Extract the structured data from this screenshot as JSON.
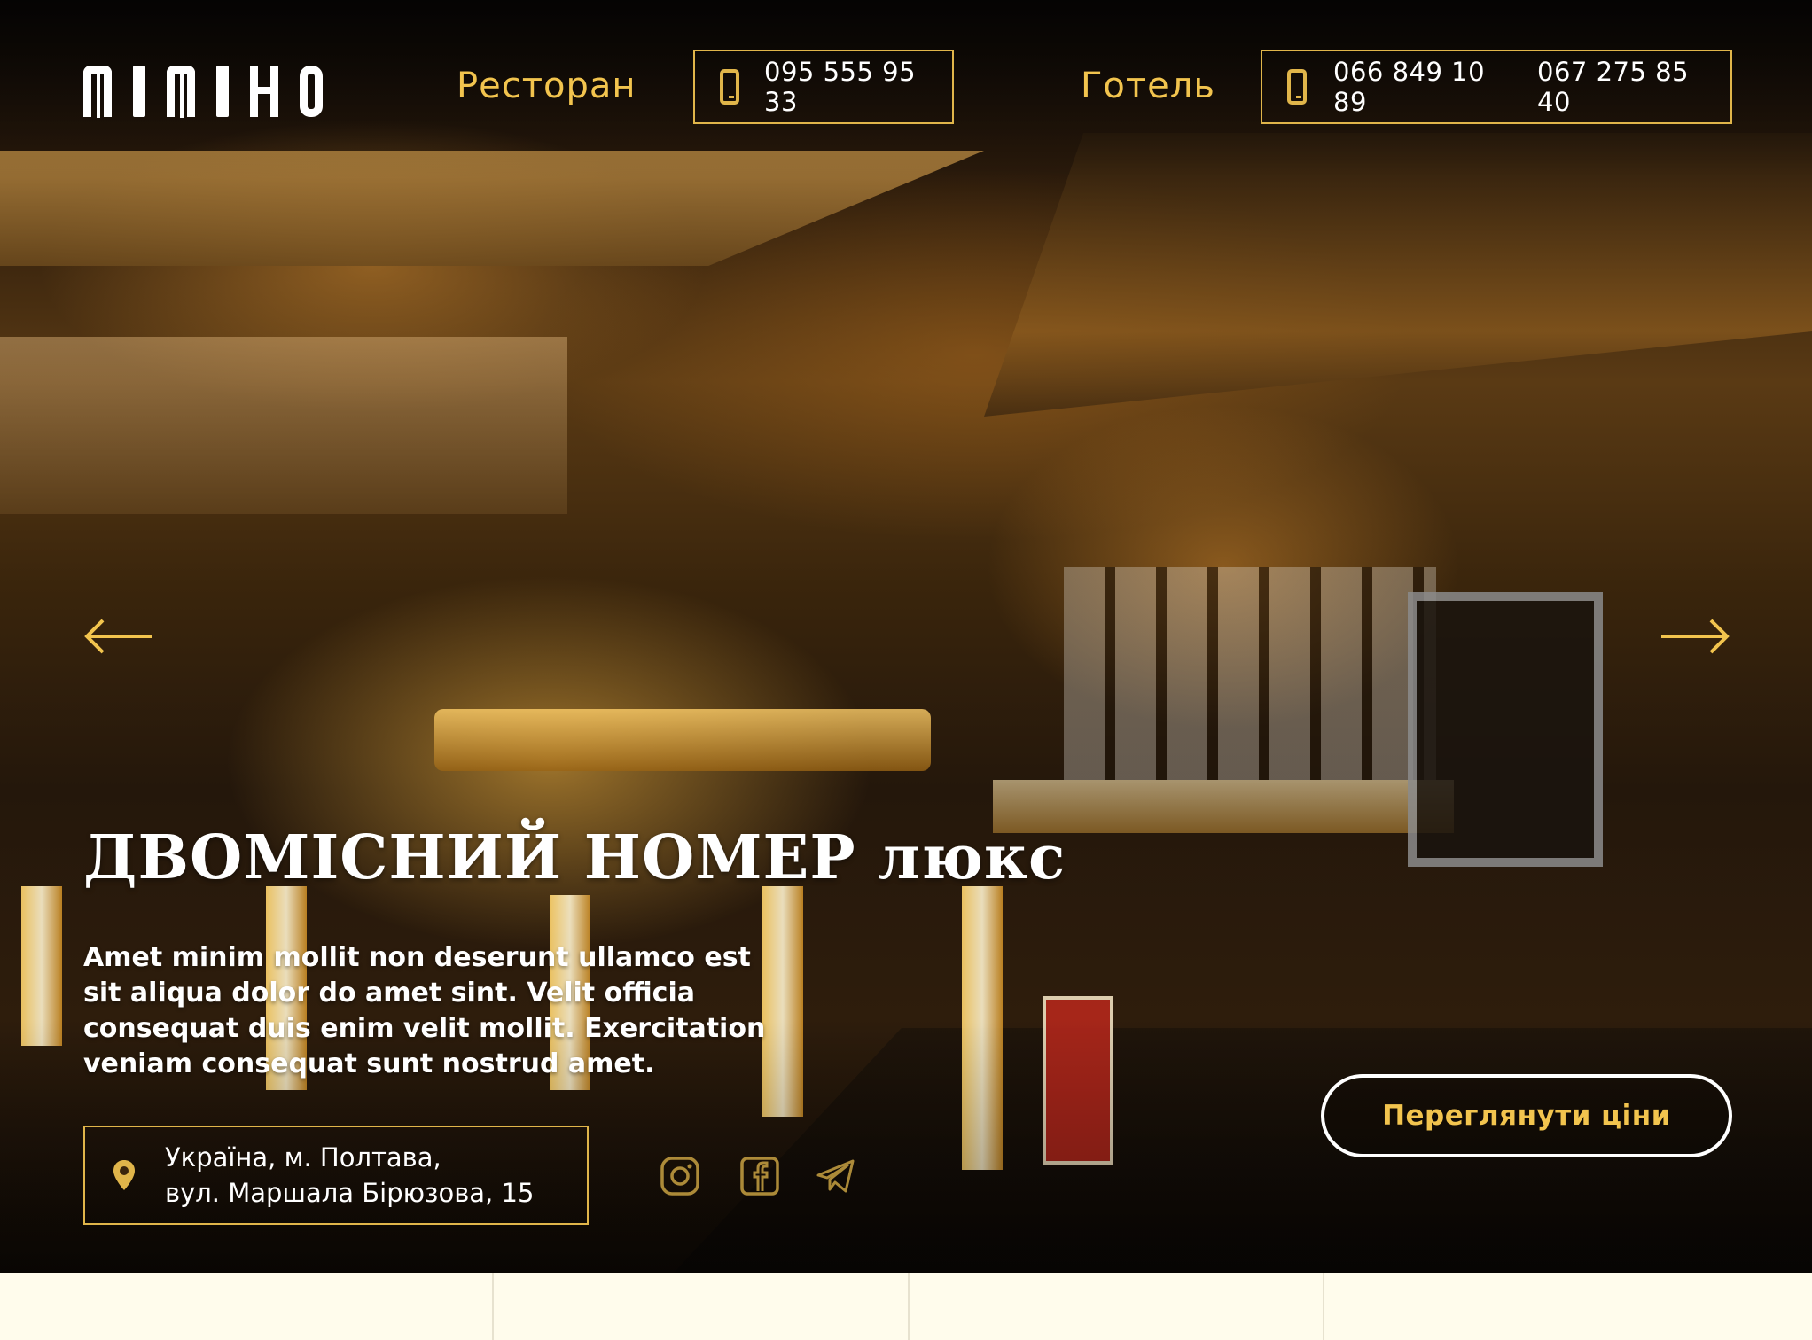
{
  "header": {
    "logo_text": "MIMIHO",
    "nav": [
      {
        "label": "Ресторан",
        "phones": [
          "095 555 95 33"
        ]
      },
      {
        "label": "Готель",
        "phones": [
          "066 849 10 89",
          "067 275 85 40"
        ]
      }
    ]
  },
  "hero": {
    "title": "ДВОМІСНИЙ НОМЕР люкс",
    "description": "Amet minim mollit non deserunt ullamco est sit aliqua dolor do amet sint. Velit officia consequat duis enim velit mollit. Exercitation veniam consequat sunt nostrud amet.",
    "address": {
      "line1": "Україна, м. Полтава,",
      "line2": "вул. Маршала Бірюзова, 15"
    },
    "cta_label": "Переглянути ціни"
  },
  "icons": {
    "phone": "phone-icon",
    "pin": "location-pin-icon",
    "prev": "arrow-left-icon",
    "next": "arrow-right-icon",
    "social": [
      "instagram-icon",
      "facebook-icon",
      "telegram-icon"
    ]
  },
  "colors": {
    "accent": "#f2c44e",
    "border_accent": "#e0b54a",
    "text": "#ffffff",
    "page_bg": "#fffcec"
  }
}
